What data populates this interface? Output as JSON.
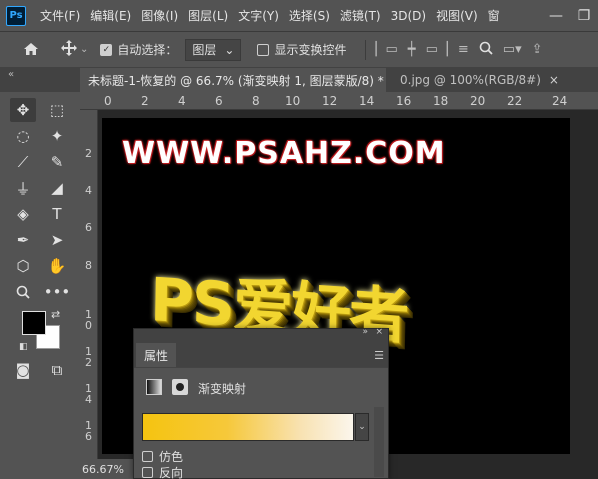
{
  "app": {
    "logo": "Ps"
  },
  "menu": [
    "文件(F)",
    "编辑(E)",
    "图像(I)",
    "图层(L)",
    "文字(Y)",
    "选择(S)",
    "滤镜(T)",
    "3D(D)",
    "视图(V)",
    "窗"
  ],
  "window_controls": {
    "minimize": "—",
    "restore": "❐"
  },
  "options_bar": {
    "auto_select_label": "自动选择：",
    "auto_select_checked": true,
    "target_value": "图层",
    "show_transform_label": "显示变换控件",
    "show_transform_checked": false
  },
  "tabs": [
    {
      "label": "未标题-1-恢复的 @ 66.7% (渐变映射 1, 图层蒙版/8) *",
      "close": "×"
    },
    {
      "label": "0.jpg @ 100%(RGB/8#)",
      "close": "×"
    }
  ],
  "ruler": {
    "top": [
      "0",
      "2",
      "4",
      "6",
      "8",
      "10",
      "12",
      "14",
      "16",
      "18",
      "20",
      "22",
      "24"
    ],
    "left": [
      "2",
      "4",
      "6",
      "8",
      "1\n0",
      "1\n2",
      "1\n4",
      "1\n6"
    ]
  },
  "canvas": {
    "site_text": "WWW.PSAHZ.COM",
    "headline": "PS爱好者"
  },
  "status": {
    "zoom": "66.67%"
  },
  "properties_panel": {
    "tab_label": "属性",
    "collapse": "»",
    "close": "×",
    "adjustment_name": "渐变映射",
    "dither_label": "仿色",
    "reverse_label": "反向",
    "dither_checked": false,
    "reverse_checked": false,
    "gradient_colors": [
      "#f5c410",
      "#fbf6ec"
    ]
  },
  "colors": {
    "ui_bg": "#535353",
    "doc_bg": "#282828",
    "foreground": "#000000",
    "background": "#ffffff",
    "headline_gold": "#f2d630"
  }
}
